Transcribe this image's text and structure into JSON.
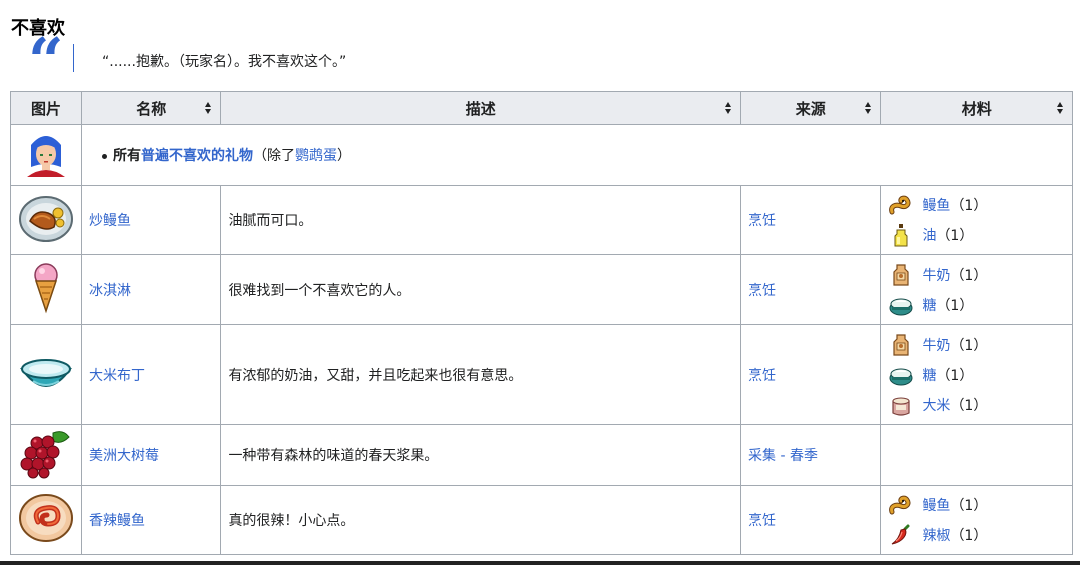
{
  "section": {
    "heading": "不喜欢"
  },
  "quote": {
    "text": "“......抱歉。（玩家名）。我不喜欢这个。”"
  },
  "table": {
    "headers": {
      "image": "图片",
      "name": "名称",
      "description": "描述",
      "source": "来源",
      "materials": "材料"
    },
    "universal_row": {
      "prefix": "所有",
      "link": "普遍不喜欢的礼物",
      "paren_open": "（除了",
      "exception": "鹦鹉蛋",
      "paren_close": "）"
    },
    "rows": [
      {
        "name": "炒鳗鱼",
        "description": "油腻而可口。",
        "source": "烹饪",
        "materials": [
          {
            "name": "鳗鱼",
            "qty": "（1）",
            "icon": "eel-icon"
          },
          {
            "name": "油",
            "qty": "（1）",
            "icon": "oil-icon"
          }
        ]
      },
      {
        "name": "冰淇淋",
        "description": "很难找到一个不喜欢它的人。",
        "source": "烹饪",
        "materials": [
          {
            "name": "牛奶",
            "qty": "（1）",
            "icon": "milk-icon"
          },
          {
            "name": "糖",
            "qty": "（1）",
            "icon": "sugar-icon"
          }
        ]
      },
      {
        "name": "大米布丁",
        "description": "有浓郁的奶油，又甜，并且吃起来也很有意思。",
        "source": "烹饪",
        "materials": [
          {
            "name": "牛奶",
            "qty": "（1）",
            "icon": "milk-icon"
          },
          {
            "name": "糖",
            "qty": "（1）",
            "icon": "sugar-icon"
          },
          {
            "name": "大米",
            "qty": "（1）",
            "icon": "rice-icon"
          }
        ]
      },
      {
        "name": "美洲大树莓",
        "description": "一种带有森林的味道的春天浆果。",
        "source": "采集 - 春季",
        "materials": []
      },
      {
        "name": "香辣鳗鱼",
        "description": "真的很辣！小心点。",
        "source": "烹饪",
        "materials": [
          {
            "name": "鳗鱼",
            "qty": "（1）",
            "icon": "eel-icon"
          },
          {
            "name": "辣椒",
            "qty": "（1）",
            "icon": "pepper-icon"
          }
        ]
      }
    ]
  }
}
